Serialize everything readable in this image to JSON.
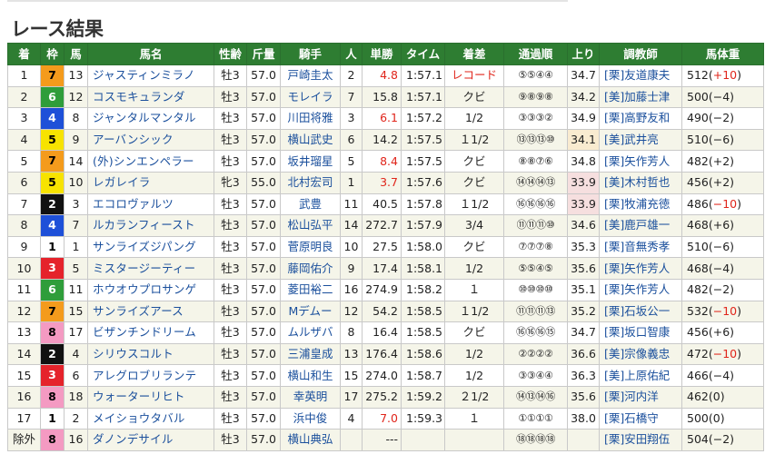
{
  "page": {
    "title": "レース結果"
  },
  "table": {
    "headers": [
      "着",
      "枠",
      "馬",
      "馬名",
      "性齢",
      "斤量",
      "騎手",
      "人",
      "単勝",
      "タイム",
      "着差",
      "通過順",
      "上り",
      "調教師",
      "馬体重"
    ],
    "rows": [
      {
        "rank": "1",
        "waku": "7",
        "num": "13",
        "horse": "ジャスティンミラノ",
        "sex": "牡3",
        "kin": "57.0",
        "jockey": "戸崎圭太",
        "pop": "2",
        "odds": "4.8",
        "time": "1:57.1",
        "diff": "レコード",
        "corner": "⑤⑤④④",
        "agari": "34.7",
        "trainer": "[栗]友道康夫",
        "weight": "512(",
        "wchange": "+10",
        "wclose": ")"
      },
      {
        "rank": "2",
        "waku": "6",
        "num": "12",
        "horse": "コスモキュランダ",
        "sex": "牡3",
        "kin": "57.0",
        "jockey": "モレイラ",
        "pop": "7",
        "odds": "15.8",
        "time": "1:57.1",
        "diff": "クビ",
        "corner": "⑨⑧⑨⑧",
        "agari": "34.2",
        "trainer": "[美]加藤士津",
        "weight": "500(−4)",
        "wchange": "",
        "wclose": ""
      },
      {
        "rank": "3",
        "waku": "4",
        "num": "8",
        "horse": "ジャンタルマンタル",
        "sex": "牡3",
        "kin": "57.0",
        "jockey": "川田将雅",
        "pop": "3",
        "odds": "6.1",
        "time": "1:57.2",
        "diff": "1/2",
        "corner": "③③③②",
        "agari": "34.9",
        "trainer": "[栗]高野友和",
        "weight": "490(−2)",
        "wchange": "",
        "wclose": ""
      },
      {
        "rank": "4",
        "waku": "5",
        "num": "9",
        "horse": "アーバンシック",
        "sex": "牡3",
        "kin": "57.0",
        "jockey": "横山武史",
        "pop": "6",
        "odds": "14.2",
        "time": "1:57.5",
        "diff": "１1/2",
        "corner": "⑬⑬⑬⑩",
        "agari": "34.1",
        "trainer": "[美]武井亮",
        "weight": "510(−6)",
        "wchange": "",
        "wclose": ""
      },
      {
        "rank": "5",
        "waku": "7",
        "num": "14",
        "horse": "(外)シンエンペラー",
        "sex": "牡3",
        "kin": "57.0",
        "jockey": "坂井瑠星",
        "pop": "5",
        "odds": "8.4",
        "time": "1:57.5",
        "diff": "クビ",
        "corner": "⑧⑧⑦⑥",
        "agari": "34.8",
        "trainer": "[栗]矢作芳人",
        "weight": "482(+2)",
        "wchange": "",
        "wclose": ""
      },
      {
        "rank": "6",
        "waku": "5",
        "num": "10",
        "horse": "レガレイラ",
        "sex": "牝3",
        "kin": "55.0",
        "jockey": "北村宏司",
        "pop": "1",
        "odds": "3.7",
        "time": "1:57.6",
        "diff": "クビ",
        "corner": "⑭⑭⑭⑬",
        "agari": "33.9",
        "trainer": "[美]木村哲也",
        "weight": "456(+2)",
        "wchange": "",
        "wclose": ""
      },
      {
        "rank": "7",
        "waku": "2",
        "num": "3",
        "horse": "エコロヴァルツ",
        "sex": "牡3",
        "kin": "57.0",
        "jockey": "武豊",
        "pop": "11",
        "odds": "40.5",
        "time": "1:57.8",
        "diff": "１1/2",
        "corner": "⑯⑯⑯⑯",
        "agari": "33.9",
        "trainer": "[栗]牧浦充徳",
        "weight": "486(",
        "wchange": "−10",
        "wclose": ")"
      },
      {
        "rank": "8",
        "waku": "4",
        "num": "7",
        "horse": "ルカランフィースト",
        "sex": "牡3",
        "kin": "57.0",
        "jockey": "松山弘平",
        "pop": "14",
        "odds": "272.7",
        "time": "1:57.9",
        "diff": "3/4",
        "corner": "⑪⑪⑪⑩",
        "agari": "34.6",
        "trainer": "[美]鹿戸雄一",
        "weight": "468(+6)",
        "wchange": "",
        "wclose": ""
      },
      {
        "rank": "9",
        "waku": "1",
        "num": "1",
        "horse": "サンライズジパング",
        "sex": "牡3",
        "kin": "57.0",
        "jockey": "菅原明良",
        "pop": "10",
        "odds": "27.5",
        "time": "1:58.0",
        "diff": "クビ",
        "corner": "⑦⑦⑦⑧",
        "agari": "35.3",
        "trainer": "[栗]音無秀孝",
        "weight": "510(−6)",
        "wchange": "",
        "wclose": ""
      },
      {
        "rank": "10",
        "waku": "3",
        "num": "5",
        "horse": "ミスタージーティー",
        "sex": "牡3",
        "kin": "57.0",
        "jockey": "藤岡佑介",
        "pop": "9",
        "odds": "17.4",
        "time": "1:58.1",
        "diff": "1/2",
        "corner": "⑤⑤④⑤",
        "agari": "35.6",
        "trainer": "[栗]矢作芳人",
        "weight": "468(−4)",
        "wchange": "",
        "wclose": ""
      },
      {
        "rank": "11",
        "waku": "6",
        "num": "11",
        "horse": "ホウオウプロサンゲ",
        "sex": "牡3",
        "kin": "57.0",
        "jockey": "菱田裕二",
        "pop": "16",
        "odds": "274.9",
        "time": "1:58.2",
        "diff": "１",
        "corner": "⑩⑩⑩⑩",
        "agari": "35.1",
        "trainer": "[栗]矢作芳人",
        "weight": "482(−2)",
        "wchange": "",
        "wclose": ""
      },
      {
        "rank": "12",
        "waku": "7",
        "num": "15",
        "horse": "サンライズアース",
        "sex": "牡3",
        "kin": "57.0",
        "jockey": "Mデムー",
        "pop": "12",
        "odds": "54.2",
        "time": "1:58.5",
        "diff": "１1/2",
        "corner": "⑪⑪⑪⑬",
        "agari": "35.2",
        "trainer": "[栗]石坂公一",
        "weight": "532(",
        "wchange": "−10",
        "wclose": ")"
      },
      {
        "rank": "13",
        "waku": "8",
        "num": "17",
        "horse": "ビザンチンドリーム",
        "sex": "牡3",
        "kin": "57.0",
        "jockey": "ムルザバ",
        "pop": "8",
        "odds": "16.4",
        "time": "1:58.5",
        "diff": "クビ",
        "corner": "⑯⑯⑯⑮",
        "agari": "34.7",
        "trainer": "[栗]坂口智康",
        "weight": "456(+6)",
        "wchange": "",
        "wclose": ""
      },
      {
        "rank": "14",
        "waku": "2",
        "num": "4",
        "horse": "シリウスコルト",
        "sex": "牡3",
        "kin": "57.0",
        "jockey": "三浦皇成",
        "pop": "13",
        "odds": "176.4",
        "time": "1:58.6",
        "diff": "1/2",
        "corner": "②②②②",
        "agari": "36.6",
        "trainer": "[美]宗像義忠",
        "weight": "472(",
        "wchange": "−10",
        "wclose": ")"
      },
      {
        "rank": "15",
        "waku": "3",
        "num": "6",
        "horse": "アレグロブリランテ",
        "sex": "牡3",
        "kin": "57.0",
        "jockey": "横山和生",
        "pop": "15",
        "odds": "274.0",
        "time": "1:58.7",
        "diff": "1/2",
        "corner": "③③④④",
        "agari": "36.3",
        "trainer": "[美]上原佑紀",
        "weight": "466(−4)",
        "wchange": "",
        "wclose": ""
      },
      {
        "rank": "16",
        "waku": "8",
        "num": "18",
        "horse": "ウォーターリヒト",
        "sex": "牡3",
        "kin": "57.0",
        "jockey": "幸英明",
        "pop": "17",
        "odds": "275.2",
        "time": "1:59.2",
        "diff": "２1/2",
        "corner": "⑭⑬⑭⑯",
        "agari": "35.6",
        "trainer": "[栗]河内洋",
        "weight": "462(0)",
        "wchange": "",
        "wclose": ""
      },
      {
        "rank": "17",
        "waku": "1",
        "num": "2",
        "horse": "メイショウタバル",
        "sex": "牡3",
        "kin": "57.0",
        "jockey": "浜中俊",
        "pop": "4",
        "odds": "7.0",
        "time": "1:59.3",
        "diff": "１",
        "corner": "①①①①",
        "agari": "38.0",
        "trainer": "[栗]石橋守",
        "weight": "500(0)",
        "wchange": "",
        "wclose": ""
      },
      {
        "rank": "除外",
        "waku": "8",
        "num": "16",
        "horse": "ダノンデサイル",
        "sex": "牡3",
        "kin": "57.0",
        "jockey": "横山典弘",
        "pop": "",
        "odds": "---",
        "time": "",
        "diff": "",
        "corner": "⑱⑱⑱⑱",
        "agari": "",
        "trainer": "[栗]安田翔伍",
        "weight": "504(−2)",
        "wchange": "",
        "wclose": ""
      }
    ],
    "red_odds_rows": [
      0,
      2,
      4,
      5,
      16
    ],
    "highlight_agari": {
      "3": "hi",
      "5": "hipink",
      "6": "hipink"
    },
    "colors": {
      "header_bg": "#2e7d32",
      "link": "#1a4f9c",
      "alert_red": "#e0251b"
    }
  }
}
